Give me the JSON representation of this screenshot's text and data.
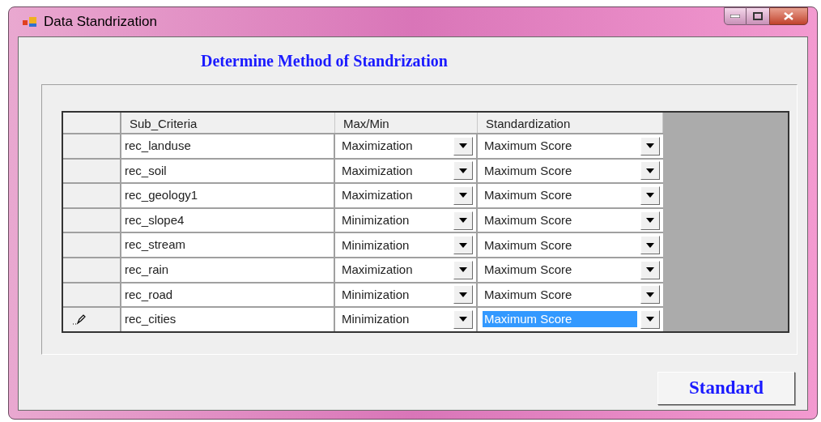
{
  "window": {
    "title": "Data Standrization"
  },
  "heading": "Determine Method of Standrization",
  "table": {
    "columns": [
      "Sub_Criteria",
      "Max/Min",
      "Standardization"
    ],
    "rows": [
      {
        "sub_criteria": "rec_landuse",
        "max_min": "Maximization",
        "standardization": "Maximum Score",
        "editing": false,
        "selected": false
      },
      {
        "sub_criteria": "rec_soil",
        "max_min": "Maximization",
        "standardization": "Maximum Score",
        "editing": false,
        "selected": false
      },
      {
        "sub_criteria": "rec_geology1",
        "max_min": "Maximization",
        "standardization": "Maximum Score",
        "editing": false,
        "selected": false
      },
      {
        "sub_criteria": "rec_slope4",
        "max_min": "Minimization",
        "standardization": "Maximum Score",
        "editing": false,
        "selected": false
      },
      {
        "sub_criteria": "rec_stream",
        "max_min": "Minimization",
        "standardization": "Maximum Score",
        "editing": false,
        "selected": false
      },
      {
        "sub_criteria": "rec_rain",
        "max_min": "Maximization",
        "standardization": "Maximum Score",
        "editing": false,
        "selected": false
      },
      {
        "sub_criteria": "rec_road",
        "max_min": "Minimization",
        "standardization": "Maximum Score",
        "editing": false,
        "selected": false
      },
      {
        "sub_criteria": "rec_cities",
        "max_min": "Minimization",
        "standardization": "Maximum Score",
        "editing": true,
        "selected": true
      }
    ]
  },
  "buttons": [
    "Standard"
  ]
}
